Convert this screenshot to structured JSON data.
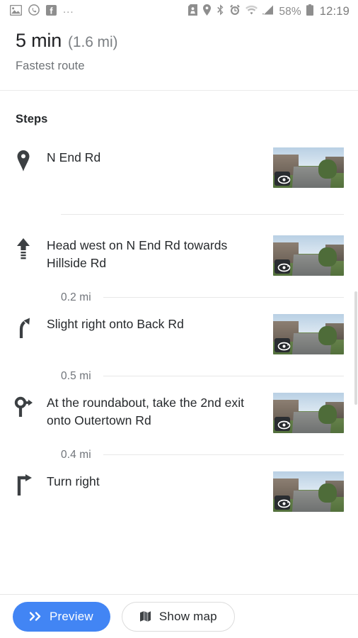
{
  "statusbar": {
    "left_icons": [
      "photo-icon",
      "whatsapp-icon",
      "facebook-icon"
    ],
    "overflow": "...",
    "right_icons": [
      "sd-card-icon",
      "location-icon",
      "bluetooth-icon",
      "alarm-icon",
      "wifi-icon",
      "signal-icon"
    ],
    "battery_percent": "58%",
    "battery_icon": "battery-icon",
    "time": "12:19"
  },
  "header": {
    "duration": "5 min",
    "distance": "(1.6 mi)",
    "route_type": "Fastest route"
  },
  "steps_section": {
    "title": "Steps",
    "items": [
      {
        "icon": "map-pin-icon",
        "text": "N End Rd",
        "thumbnail": "street-view-thumbnail",
        "badge": "street-view-badge",
        "distance": null,
        "divider": "plain"
      },
      {
        "icon": "straight-arrow-icon",
        "text": "Head west on N End Rd towards Hillside Rd",
        "thumbnail": "street-view-thumbnail",
        "badge": "street-view-badge",
        "distance": "0.2 mi",
        "divider": "distance"
      },
      {
        "icon": "slight-right-arrow-icon",
        "text": "Slight right onto Back Rd",
        "thumbnail": "street-view-thumbnail",
        "badge": "street-view-badge",
        "distance": "0.5 mi",
        "divider": "distance"
      },
      {
        "icon": "roundabout-icon",
        "text": "At the roundabout, take the 2nd exit onto Outertown Rd",
        "thumbnail": "street-view-thumbnail",
        "badge": "street-view-badge",
        "distance": "0.4 mi",
        "divider": "distance"
      },
      {
        "icon": "turn-right-arrow-icon",
        "text": "Turn right",
        "thumbnail": "street-view-thumbnail",
        "badge": "street-view-badge",
        "distance": null,
        "divider": "none"
      }
    ]
  },
  "bottom_bar": {
    "preview_label": "Preview",
    "preview_icon": "double-chevron-right-icon",
    "show_map_label": "Show map",
    "show_map_icon": "map-icon"
  },
  "colors": {
    "accent_blue": "#4285f4",
    "text_primary": "#26292c",
    "text_secondary": "#70747a",
    "divider": "#e8e8e8"
  }
}
